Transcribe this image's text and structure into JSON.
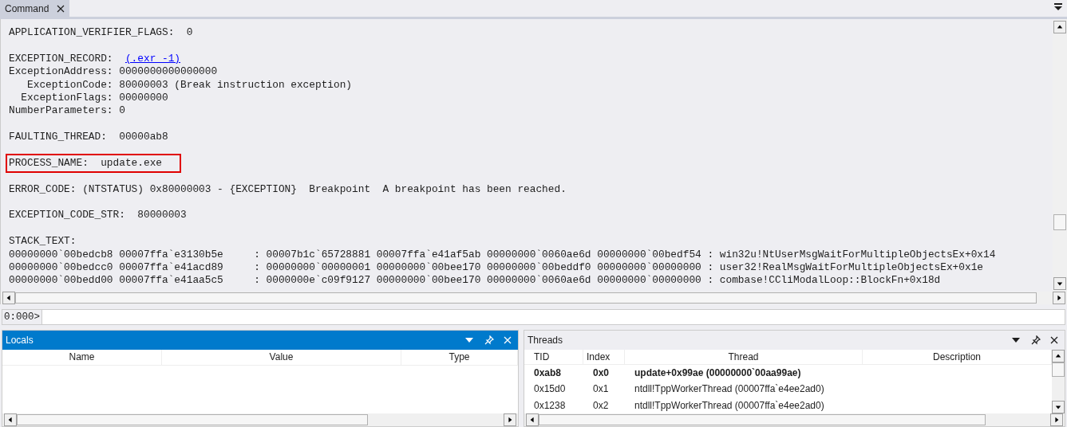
{
  "command_window": {
    "tab": {
      "label": "Command",
      "selected": true
    },
    "lines": [
      {
        "kind": "text",
        "text": "APPLICATION_VERIFIER_FLAGS:  0"
      },
      {
        "kind": "blank"
      },
      {
        "kind": "link",
        "text": "EXCEPTION_RECORD:  ",
        "link": "(.exr -1)"
      },
      {
        "kind": "text",
        "text": "ExceptionAddress: 0000000000000000"
      },
      {
        "kind": "text",
        "text": "   ExceptionCode: 80000003 (Break instruction exception)"
      },
      {
        "kind": "text",
        "text": "  ExceptionFlags: 00000000"
      },
      {
        "kind": "text",
        "text": "NumberParameters: 0"
      },
      {
        "kind": "blank"
      },
      {
        "kind": "text",
        "text": "FAULTING_THREAD:  00000ab8"
      },
      {
        "kind": "blank"
      },
      {
        "kind": "highlight",
        "text": "PROCESS_NAME:  update.exe"
      },
      {
        "kind": "blank"
      },
      {
        "kind": "text",
        "text": "ERROR_CODE: (NTSTATUS) 0x80000003 - {EXCEPTION}  Breakpoint  A breakpoint has been reached."
      },
      {
        "kind": "blank"
      },
      {
        "kind": "text",
        "text": "EXCEPTION_CODE_STR:  80000003"
      },
      {
        "kind": "blank"
      },
      {
        "kind": "text",
        "text": "STACK_TEXT:"
      },
      {
        "kind": "text",
        "text": "00000000`00bedcb8 00007ffa`e3130b5e     : 00007b1c`65728881 00007ffa`e41af5ab 00000000`0060ae6d 00000000`00bedf54 : win32u!NtUserMsgWaitForMultipleObjectsEx+0x14"
      },
      {
        "kind": "text",
        "text": "00000000`00bedcc0 00007ffa`e41acd89     : 00000000`00000001 00000000`00bee170 00000000`00beddf0 00000000`00000000 : user32!RealMsgWaitForMultipleObjectsEx+0x1e"
      },
      {
        "kind": "text",
        "text": "00000000`00bedd00 00007ffa`e41aa5c5     : 0000000e`c09f9127 00000000`00bee170 00000000`0060ae6d 00000000`00000000 : combase!CCliModalLoop::BlockFn+0x18d"
      }
    ],
    "prompt": "0:000>"
  },
  "locals": {
    "title": "Locals",
    "active": true,
    "columns": [
      "Name",
      "Value",
      "Type"
    ]
  },
  "threads": {
    "title": "Threads",
    "active": false,
    "columns": [
      "TID",
      "Index",
      "Thread",
      "Description"
    ],
    "rows": [
      {
        "tid": "0xab8",
        "index": "0x0",
        "thread": "update+0x99ae (00000000`00aa99ae)",
        "current": true
      },
      {
        "tid": "0x15d0",
        "index": "0x1",
        "thread": "ntdll!TppWorkerThread (00007ffa`e4ee2ad0)",
        "current": false
      },
      {
        "tid": "0x1238",
        "index": "0x2",
        "thread": "ntdll!TppWorkerThread (00007ffa`e4ee2ad0)",
        "current": false
      }
    ]
  }
}
